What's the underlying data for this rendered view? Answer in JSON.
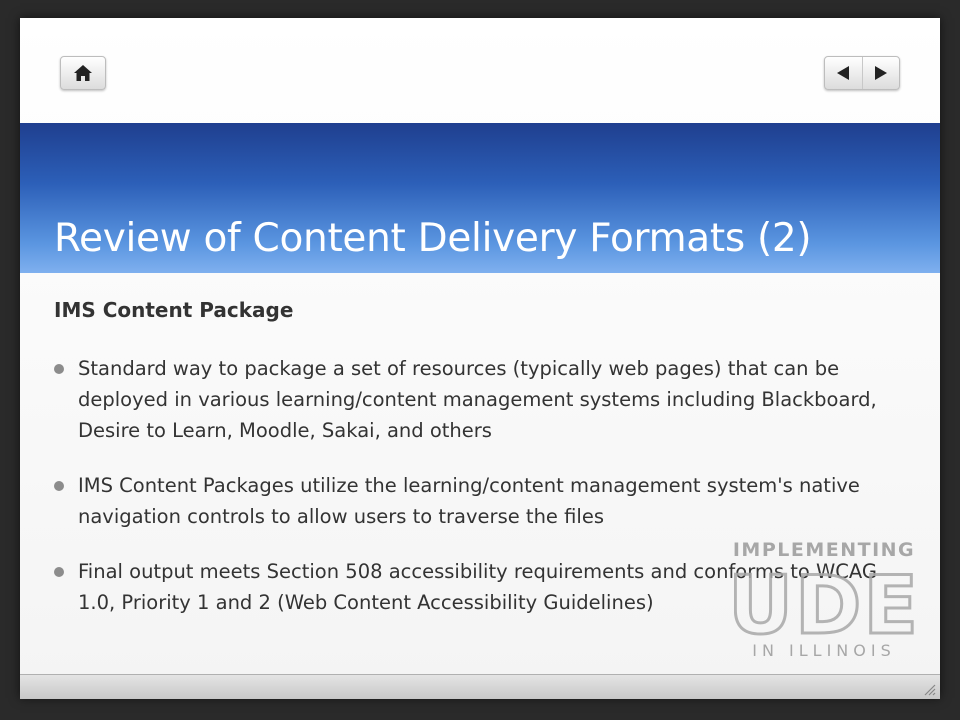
{
  "nav": {
    "home_icon": "home-icon",
    "prev_icon": "triangle-left-icon",
    "next_icon": "triangle-right-icon"
  },
  "slide": {
    "title": "Review of Content Delivery Formats (2)",
    "subtitle": "IMS Content Package",
    "bullets": [
      "Standard way to package a set of resources (typically web pages) that can be deployed in various learning/content management systems including Blackboard, Desire to Learn, Moodle, Sakai, and others",
      "IMS Content Packages utilize the learning/content management system's native navigation controls to allow users to traverse the files",
      "Final output meets Section 508 accessibility requirements and conforms to WCAG 1.0, Priority 1 and 2 (Web Content Accessibility Guidelines)"
    ]
  },
  "logo": {
    "top_text": "IMPLEMENTING",
    "letters": "UDE",
    "bottom_text": "IN ILLINOIS"
  },
  "colors": {
    "title_band": "#2c5fb8",
    "text": "#333333",
    "logo_gray": "#9a9a9a"
  }
}
